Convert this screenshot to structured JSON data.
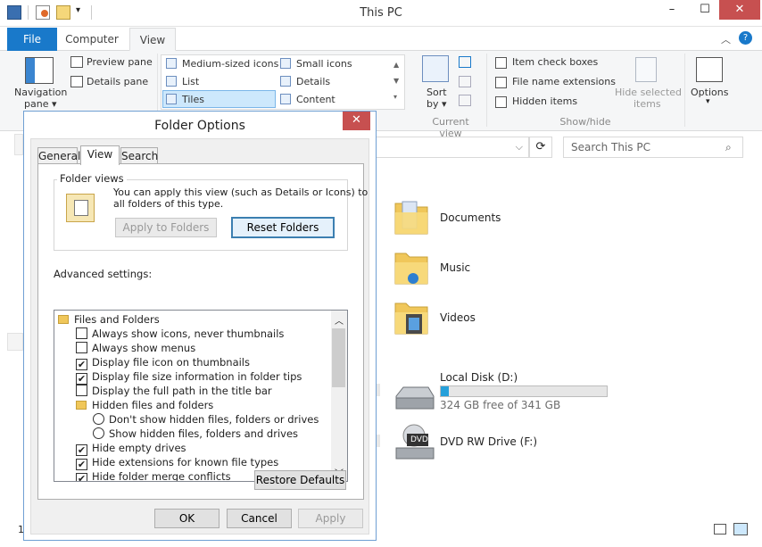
{
  "window": {
    "title": "This PC",
    "minimize": "–",
    "maximize": "☐",
    "close": "✕"
  },
  "tabs": {
    "file": "File",
    "computer": "Computer",
    "view": "View"
  },
  "ribbon": {
    "nav_pane": "Navigation",
    "nav_pane2": "pane",
    "preview_pane": "Preview pane",
    "details_pane": "Details pane",
    "layouts": [
      "Medium-sized icons",
      "Small icons",
      "List",
      "Details",
      "Tiles",
      "Content"
    ],
    "sort_by": "Sort",
    "sort_by2": "by",
    "current_view": "Current view",
    "item_check_boxes": "Item check boxes",
    "file_name_ext": "File name extensions",
    "hidden_items": "Hidden items",
    "hide_selected": "Hide selected",
    "hide_selected2": "items",
    "show_hide": "Show/hide",
    "options": "Options"
  },
  "search": {
    "placeholder": "Search This PC"
  },
  "content": {
    "folders": [
      "Documents",
      "Music",
      "Videos"
    ],
    "drive_d_name": "Local Disk (D:)",
    "drive_d_free": "324 GB free of 341 GB",
    "drive_d_used_fraction": 0.05,
    "dvd_name": "DVD RW Drive (F:)",
    "dvd_label": "DVD"
  },
  "status": {
    "count": "1"
  },
  "dialog": {
    "title": "Folder Options",
    "close": "✕",
    "tabs": [
      "General",
      "View",
      "Search"
    ],
    "folder_views_label": "Folder views",
    "folder_views_text1": "You can apply this view (such as Details or Icons) to",
    "folder_views_text2": "all folders of this type.",
    "apply_to_folders": "Apply to Folders",
    "reset_folders": "Reset Folders",
    "advanced_settings": "Advanced settings:",
    "tree": [
      {
        "kind": "folder",
        "label": "Files and Folders",
        "indent": 0
      },
      {
        "kind": "check",
        "label": "Always show icons, never thumbnails",
        "checked": false
      },
      {
        "kind": "check",
        "label": "Always show menus",
        "checked": false
      },
      {
        "kind": "check",
        "label": "Display file icon on thumbnails",
        "checked": true
      },
      {
        "kind": "check",
        "label": "Display file size information in folder tips",
        "checked": true
      },
      {
        "kind": "check",
        "label": "Display the full path in the title bar",
        "checked": false
      },
      {
        "kind": "folder2",
        "label": "Hidden files and folders"
      },
      {
        "kind": "radio",
        "label": "Don't show hidden files, folders or drives"
      },
      {
        "kind": "radio",
        "label": "Show hidden files, folders and drives"
      },
      {
        "kind": "check",
        "label": "Hide empty drives",
        "checked": true
      },
      {
        "kind": "check",
        "label": "Hide extensions for known file types",
        "checked": true
      },
      {
        "kind": "check",
        "label": "Hide folder merge conflicts",
        "checked": true
      }
    ],
    "restore_defaults": "Restore Defaults",
    "ok": "OK",
    "cancel": "Cancel",
    "apply": "Apply"
  }
}
